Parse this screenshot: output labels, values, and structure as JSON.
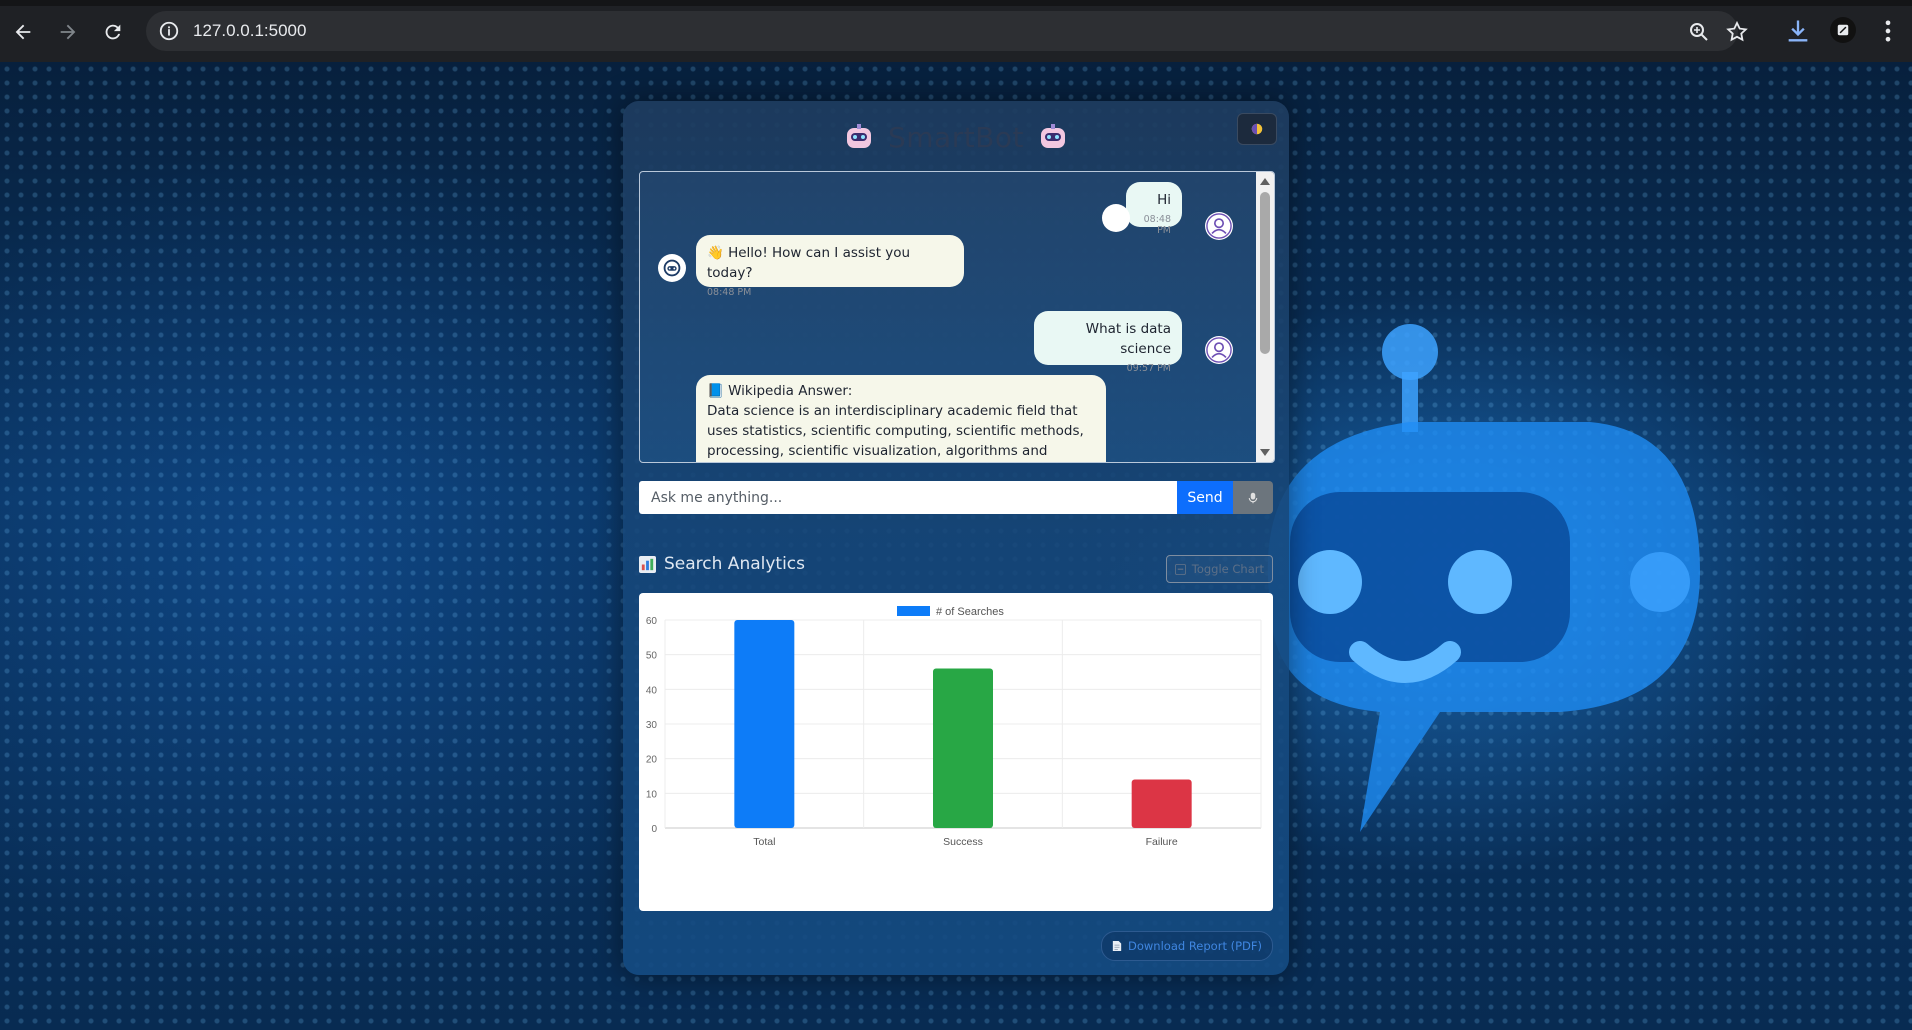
{
  "browser": {
    "url": "127.0.0.1:5000"
  },
  "app": {
    "title": "SmartBot",
    "theme_toggle_icon": "half-moon-icon"
  },
  "chat": {
    "messages": [
      {
        "sender": "user",
        "lines": [
          "Hi"
        ],
        "time": "08:48 PM"
      },
      {
        "sender": "bot",
        "lines": [
          "👋 Hello! How can I assist you today?"
        ],
        "time": "08:48 PM"
      },
      {
        "sender": "user",
        "lines": [
          "What is data science"
        ],
        "time": "09:57 PM"
      },
      {
        "sender": "bot",
        "lines": [
          "📘 Wikipedia Answer:",
          "Data science is an interdisciplinary academic field that",
          "uses statistics, scientific computing, scientific methods,",
          "processing, scientific visualization, algorithms and"
        ],
        "time": ""
      }
    ]
  },
  "input": {
    "placeholder": "Ask me anything...",
    "value": "",
    "send_label": "Send",
    "mic_icon": "microphone-icon"
  },
  "analytics": {
    "title": "Search Analytics",
    "title_icon": "bar-chart-icon",
    "toggle_label": "Toggle Chart",
    "download_label": "Download Report (PDF)"
  },
  "chart_data": {
    "type": "bar",
    "categories": [
      "Total",
      "Success",
      "Failure"
    ],
    "series": [
      {
        "name": "# of Searches",
        "values": [
          60,
          46,
          14
        ],
        "colors": [
          "#0d7cf8",
          "#28a745",
          "#dc3545"
        ]
      }
    ],
    "title": "",
    "xlabel": "",
    "ylabel": "",
    "ylim": [
      0,
      60
    ],
    "yticks": [
      0,
      10,
      20,
      30,
      40,
      50,
      60
    ],
    "legend_position": "top",
    "grid": true
  }
}
